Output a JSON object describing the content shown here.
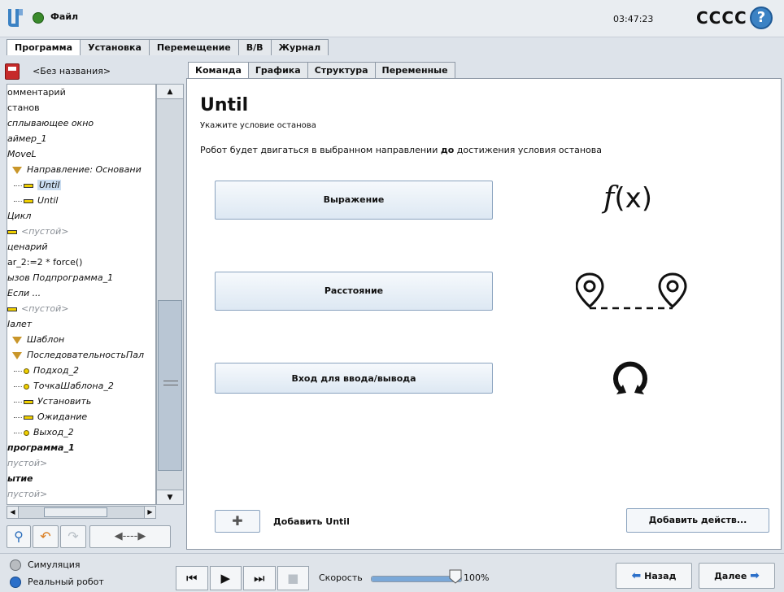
{
  "topbar": {
    "file_label": "Файл",
    "clock": "03:47:23",
    "robot_name": "CCCC",
    "help_icon": "?"
  },
  "main_tabs": [
    {
      "label": "Программа",
      "active": true
    },
    {
      "label": "Установка",
      "active": false
    },
    {
      "label": "Перемещение",
      "active": false
    },
    {
      "label": "В/В",
      "active": false
    },
    {
      "label": "Журнал",
      "active": false
    }
  ],
  "program": {
    "name": "<Без названия>"
  },
  "tree": [
    {
      "text": "омментарий",
      "style": "plain"
    },
    {
      "text": "станов",
      "style": "plain"
    },
    {
      "text": "сплывающее окно",
      "style": "it"
    },
    {
      "text": "аймер_1",
      "style": "it"
    },
    {
      "text": "MoveL",
      "style": "it"
    },
    {
      "text": "Направление: Основани",
      "style": "it"
    },
    {
      "text": "Until",
      "style": "it"
    },
    {
      "text": "Until",
      "style": "it"
    },
    {
      "text": "Цикл",
      "style": "it"
    },
    {
      "text": "<пустой>",
      "style": "it"
    },
    {
      "text": "ценарий",
      "style": "it"
    },
    {
      "text": "ar_2:=2 * force()",
      "style": "plain"
    },
    {
      "text": "ызов Подпрограмма_1",
      "style": "it"
    },
    {
      "text": "Если ...",
      "style": "it"
    },
    {
      "text": "<пустой>",
      "style": "it"
    },
    {
      "text": "Іалет",
      "style": "it"
    },
    {
      "text": "Шаблон",
      "style": "it"
    },
    {
      "text": "ПоследовательностьПал",
      "style": "it"
    },
    {
      "text": "Подход_2",
      "style": "it"
    },
    {
      "text": "ТочкаШаблона_2",
      "style": "it"
    },
    {
      "text": "Установить",
      "style": "it"
    },
    {
      "text": "Ожидание",
      "style": "it"
    },
    {
      "text": "Выход_2",
      "style": "it"
    },
    {
      "text": "программа_1",
      "style": "b"
    },
    {
      "text": "пустой>",
      "style": "it"
    },
    {
      "text": "ытие",
      "style": "b"
    },
    {
      "text": "пустой>",
      "style": "it"
    }
  ],
  "sub_tabs": [
    {
      "label": "Команда",
      "active": true
    },
    {
      "label": "Графика",
      "active": false
    },
    {
      "label": "Структура",
      "active": false
    },
    {
      "label": "Переменные",
      "active": false
    }
  ],
  "command": {
    "title": "Until",
    "subtitle": "Укажите условие останова",
    "desc_before": "Робот будет двигаться в выбранном направлении ",
    "desc_bold": "до",
    "desc_after": " достижения условия останова",
    "buttons": {
      "expression": "Выражение",
      "distance": "Расстояние",
      "io": "Вход для ввода/вывода"
    },
    "fx_f": "f",
    "fx_paren": "(x)",
    "add_until_label": "Добавить Until",
    "add_action": "Добавить действ..."
  },
  "bottom": {
    "mode_sim": "Симуляция",
    "mode_real": "Реальный робот",
    "speed_label": "Скорость",
    "speed_value": "100%",
    "speed_fraction": 1.0,
    "back": "Назад",
    "next": "Далее"
  },
  "colors": {
    "accent": "#2b6fc9",
    "selection": "#c9dcf0",
    "marker": "#f0d000"
  }
}
